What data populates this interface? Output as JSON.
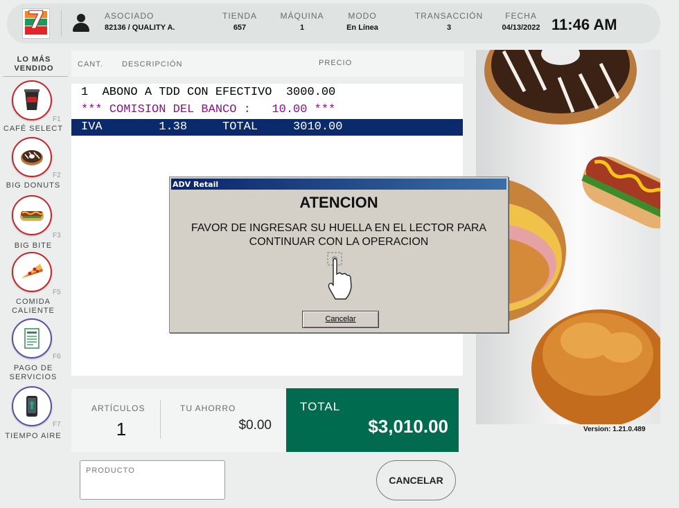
{
  "header": {
    "logo_text": "7-ELEVEn",
    "associate": {
      "label": "ASOCIADO",
      "value": "82136  / QUALITY A."
    },
    "store": {
      "label": "TIENDA",
      "value": "657"
    },
    "machine": {
      "label": "MÁQUINA",
      "value": "1"
    },
    "mode": {
      "label": "MODO",
      "value": "En Línea"
    },
    "transaction": {
      "label": "TRANSACCIÓN",
      "value": "3"
    },
    "date": {
      "label": "FECHA",
      "value": "04/13/2022"
    },
    "time": "11:46 AM"
  },
  "sidebar": {
    "title_line1": "LO MÁS",
    "title_line2": "VENDIDO",
    "items": [
      {
        "key": "F1",
        "label_line1": "CAFÉ SELECT",
        "label_line2": "",
        "icon": "coffee-cup-icon"
      },
      {
        "key": "F2",
        "label_line1": "BIG DONUTS",
        "label_line2": "",
        "icon": "donut-icon"
      },
      {
        "key": "F3",
        "label_line1": "BIG BITE",
        "label_line2": "",
        "icon": "hotdog-icon"
      },
      {
        "key": "F5",
        "label_line1": "COMIDA",
        "label_line2": "CALIENTE",
        "icon": "pizza-slice-icon"
      },
      {
        "key": "F6",
        "label_line1": "PAGO DE",
        "label_line2": "SERVICIOS",
        "icon": "bill-icon"
      },
      {
        "key": "F7",
        "label_line1": "TIEMPO AIRE",
        "label_line2": "",
        "icon": "phone-icon"
      }
    ]
  },
  "ticket": {
    "headers": {
      "qty": "CANT.",
      "desc": "DESCRIPCIÓN",
      "price": "PRECIO"
    },
    "lines": [
      "1  ABONO A TDD CON EFECTIVO  3000.00",
      "*** COMISION DEL BANCO :   10.00 ***",
      "IVA        1.38     TOTAL     3010.00"
    ]
  },
  "summary": {
    "articles_label": "ARTÍCULOS",
    "articles_value": "1",
    "savings_label": "TU AHORRO",
    "savings_value": "$0.00",
    "total_label": "TOTAL",
    "total_value": "$3,010.00"
  },
  "product": {
    "label": "PRODUCTO",
    "value": ""
  },
  "cancel_label": "CANCELAR",
  "version": "Version: 1.21.0.489",
  "dialog": {
    "window_title": "ADV Retail",
    "title": "ATENCION",
    "message_line1": "FAVOR DE INGRESAR SU HUELLA EN EL LECTOR PARA",
    "message_line2": "CONTINUAR CON LA OPERACION",
    "button_label": "Cancelar",
    "icon": "fingerprint-touch-icon"
  },
  "colors": {
    "total_green": "#006b4e",
    "ticket_highlight": "#0a2a6c",
    "commission_purple": "#8c0f8c",
    "category_ring_red": "#c72429",
    "category_ring_blue": "#5b4ea6"
  }
}
